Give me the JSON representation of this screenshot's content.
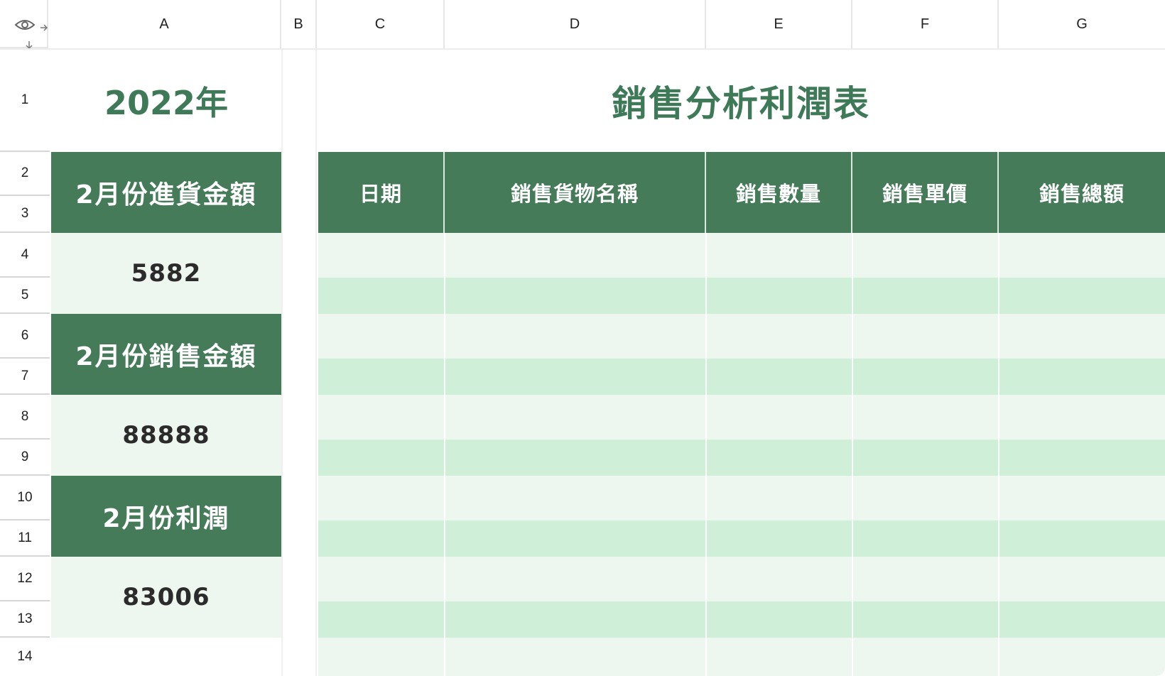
{
  "columns": [
    "A",
    "B",
    "C",
    "D",
    "E",
    "F",
    "G"
  ],
  "rows": [
    "1",
    "2",
    "3",
    "4",
    "5",
    "6",
    "7",
    "8",
    "9",
    "10",
    "11",
    "12",
    "13",
    "14"
  ],
  "icons": {
    "visibility": "eye-icon",
    "collapse_columns": "column-collapse-icon",
    "collapse_rows": "row-collapse-icon"
  },
  "left_panel": {
    "year": "2022年",
    "blocks": [
      {
        "label": "2月份進貨金額",
        "value": "5882"
      },
      {
        "label": "2月份銷售金額",
        "value": "88888"
      },
      {
        "label": "2月份利潤",
        "value": "83006"
      }
    ]
  },
  "table": {
    "title": "銷售分析利潤表",
    "headers": [
      "日期",
      "銷售貨物名稱",
      "銷售數量",
      "銷售單價",
      "銷售總額"
    ],
    "body_rows": 11
  },
  "colors": {
    "accent_green": "#467b5a",
    "title_green": "#3f7a58",
    "band_light": "#eef7ef",
    "band_mid": "#cfefd8"
  }
}
